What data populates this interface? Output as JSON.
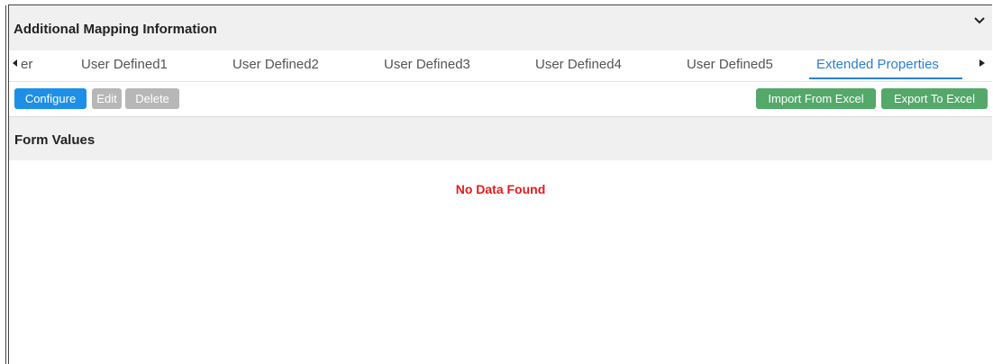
{
  "panel": {
    "title": "Additional Mapping Information"
  },
  "tabs": {
    "partial_left_label": "er",
    "items": [
      {
        "label": "User Defined1"
      },
      {
        "label": "User Defined2"
      },
      {
        "label": "User Defined3"
      },
      {
        "label": "User Defined4"
      },
      {
        "label": "User Defined5"
      },
      {
        "label": "Extended Properties",
        "active": true
      }
    ]
  },
  "toolbar": {
    "configure_label": "Configure",
    "edit_label": "Edit",
    "delete_label": "Delete",
    "import_label": "Import From Excel",
    "export_label": "Export To Excel"
  },
  "section": {
    "title": "Form Values",
    "empty_message": "No Data Found"
  },
  "colors": {
    "active_tab": "#2a7fd4",
    "primary_button": "#1e8fe6",
    "disabled_button": "#b7b7b7",
    "success_button": "#53a86a",
    "empty_message": "#e61b1b"
  },
  "icons": {
    "collapse": "chevron-down-icon",
    "scroll_left": "caret-left-icon",
    "scroll_right": "caret-right-icon"
  }
}
